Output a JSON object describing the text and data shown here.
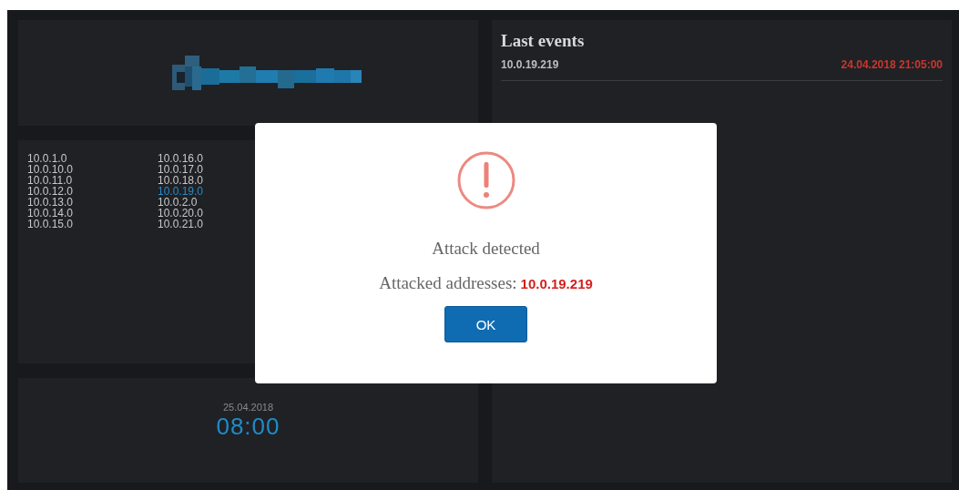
{
  "networks": [
    {
      "label": "10.0.1.0",
      "selected": false
    },
    {
      "label": "10.0.10.0",
      "selected": false
    },
    {
      "label": "10.0.11.0",
      "selected": false
    },
    {
      "label": "10.0.12.0",
      "selected": false
    },
    {
      "label": "10.0.13.0",
      "selected": false
    },
    {
      "label": "10.0.14.0",
      "selected": false
    },
    {
      "label": "10.0.15.0",
      "selected": false
    },
    {
      "label": "10.0.16.0",
      "selected": false
    },
    {
      "label": "10.0.17.0",
      "selected": false
    },
    {
      "label": "10.0.18.0",
      "selected": false
    },
    {
      "label": "10.0.19.0",
      "selected": true
    },
    {
      "label": "10.0.2.0",
      "selected": false
    },
    {
      "label": "10.0.20.0",
      "selected": false
    },
    {
      "label": "10.0.21.0",
      "selected": false
    }
  ],
  "clock": {
    "date": "25.04.2018",
    "time": "08:00"
  },
  "last_events": {
    "title": "Last events",
    "events": [
      {
        "address": "10.0.19.219",
        "time": "24.04.2018 21:05:00"
      }
    ]
  },
  "dialog": {
    "title": "Attack detected",
    "label": "Attacked addresses:",
    "address": "10.0.19.219",
    "button": "OK"
  }
}
